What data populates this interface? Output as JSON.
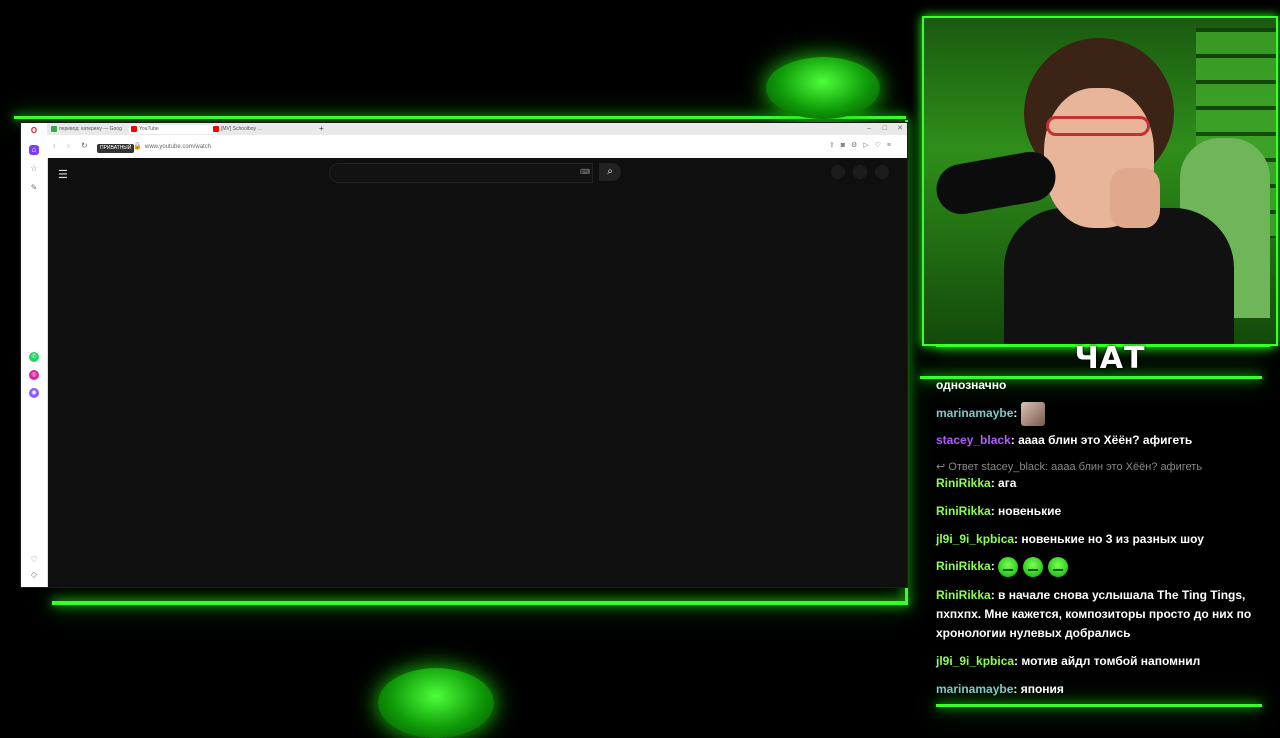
{
  "browser": {
    "tabs": [
      {
        "label": "перевод: катерину — Goog",
        "fav_color": "#34a853"
      },
      {
        "label": "YouTube",
        "fav_color": "#ff0000"
      },
      {
        "label": "[MV] Schoolboy …",
        "fav_color": "#ff0000"
      }
    ],
    "new_tab": "+",
    "private_label": "ПРИВАТНЫЙ",
    "url": "www.youtube.com/watch",
    "window_controls": [
      "–",
      "□",
      "✕"
    ]
  },
  "youtube": {
    "search_placeholder": "",
    "menu_icon": "☰",
    "search_icon": "⌕"
  },
  "chat": {
    "title": "ЧАТ",
    "messages": [
      {
        "user": "",
        "text": "однозначно",
        "color": "#ffffff"
      },
      {
        "user": "marinamaybe",
        "text": ":",
        "color": "#7ec8c8"
      },
      {
        "user": "stacey_black",
        "text": ": аааа блин это Хёён? афигеть",
        "color": "#b05cff"
      },
      {
        "reply": "↩ Ответ stacey_black: аааа блин это Хёён? афигеть"
      },
      {
        "user": "RiniRikka",
        "text": ": ага",
        "color": "#8cff4a"
      },
      {
        "user": "RiniRikka",
        "text": ": новенькие",
        "color": "#8cff4a"
      },
      {
        "user": "jl9i_9i_kpbica",
        "text": ": новенькие но 3 из разных шоу",
        "color": "#8cff4a"
      },
      {
        "user": "RiniRikka",
        "text": ":",
        "color": "#8cff4a"
      },
      {
        "user": "RiniRikka",
        "text": ": в начале снова услышала The Ting Tings, пхпхпх. Мне кажется, композиторы просто до них по хронологии нулевых добрались",
        "color": "#8cff4a"
      },
      {
        "user": "jl9i_9i_kpbica",
        "text": ": мотив айдл томбой напомнил",
        "color": "#8cff4a"
      },
      {
        "user": "marinamaybe",
        "text": ": япония",
        "color": "#7ec8c8"
      }
    ]
  }
}
